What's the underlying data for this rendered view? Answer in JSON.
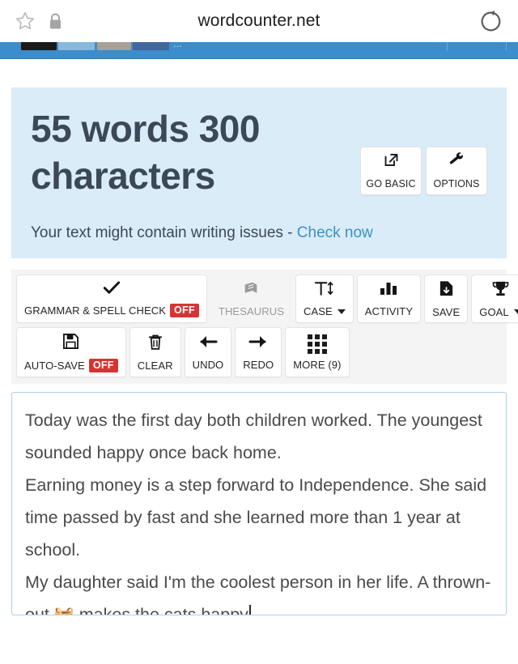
{
  "browser": {
    "url": "wordcounter.net",
    "bookmark_icon": "star-icon",
    "security_icon": "lock-icon",
    "reload_icon": "reload-icon"
  },
  "site_strip": {
    "partial_text": "...",
    "button_label": ""
  },
  "summary": {
    "count_text": "55 words 300 characters",
    "words": 55,
    "characters": 300,
    "go_basic_label": "GO BASIC",
    "go_basic_icon": "external-link-icon",
    "options_label": "OPTIONS",
    "options_icon": "wrench-icon",
    "issues_text": "Your text might contain writing issues - ",
    "issues_link": "Check now",
    "panel_bg": "#d9ecf7",
    "link_color": "#3d90c8",
    "title_color": "#3c4858"
  },
  "toolbar": {
    "row1": [
      {
        "label": "GRAMMAR & SPELL CHECK",
        "badge": "OFF",
        "icon": "check-icon",
        "disabled": false
      },
      {
        "label": "THESAURUS",
        "badge": "",
        "icon": "book-icon",
        "disabled": true
      },
      {
        "label": "CASE",
        "badge": "",
        "icon": "text-case-icon",
        "caret": true,
        "disabled": false
      },
      {
        "label": "ACTIVITY",
        "badge": "",
        "icon": "bar-chart-icon",
        "disabled": false
      },
      {
        "label": "SAVE",
        "badge": "",
        "icon": "save-file-icon",
        "disabled": false
      },
      {
        "label": "GOAL",
        "badge": "",
        "icon": "trophy-icon",
        "caret": true,
        "disabled": false
      }
    ],
    "row2": [
      {
        "label": "AUTO-SAVE",
        "badge": "OFF",
        "icon": "floppy-disk-icon",
        "disabled": false
      },
      {
        "label": "CLEAR",
        "badge": "",
        "icon": "trash-icon",
        "disabled": false
      },
      {
        "label": "UNDO",
        "badge": "",
        "icon": "arrow-left-icon",
        "disabled": false
      },
      {
        "label": "REDO",
        "badge": "",
        "icon": "arrow-right-icon",
        "disabled": false
      },
      {
        "label": "MORE (9)",
        "badge": "",
        "icon": "grid-icon",
        "disabled": false
      }
    ],
    "badge_color": "#d63434",
    "background": "#f4f4f4"
  },
  "editor": {
    "line1": "Today was the first day both children worked. The youngest sounded happy once back home.",
    "line2": "Earning money is a step forward to Independence. She said time passed by fast and she learned more than 1 year at school.",
    "line3_pre": "My daughter said I'm the coolest person in her life. A thrown-out ",
    "line3_emoji": "🧺",
    "line3_post": " makes the cats happy",
    "border_color": "#a8d2ea",
    "text_color": "#4a4a4a"
  }
}
